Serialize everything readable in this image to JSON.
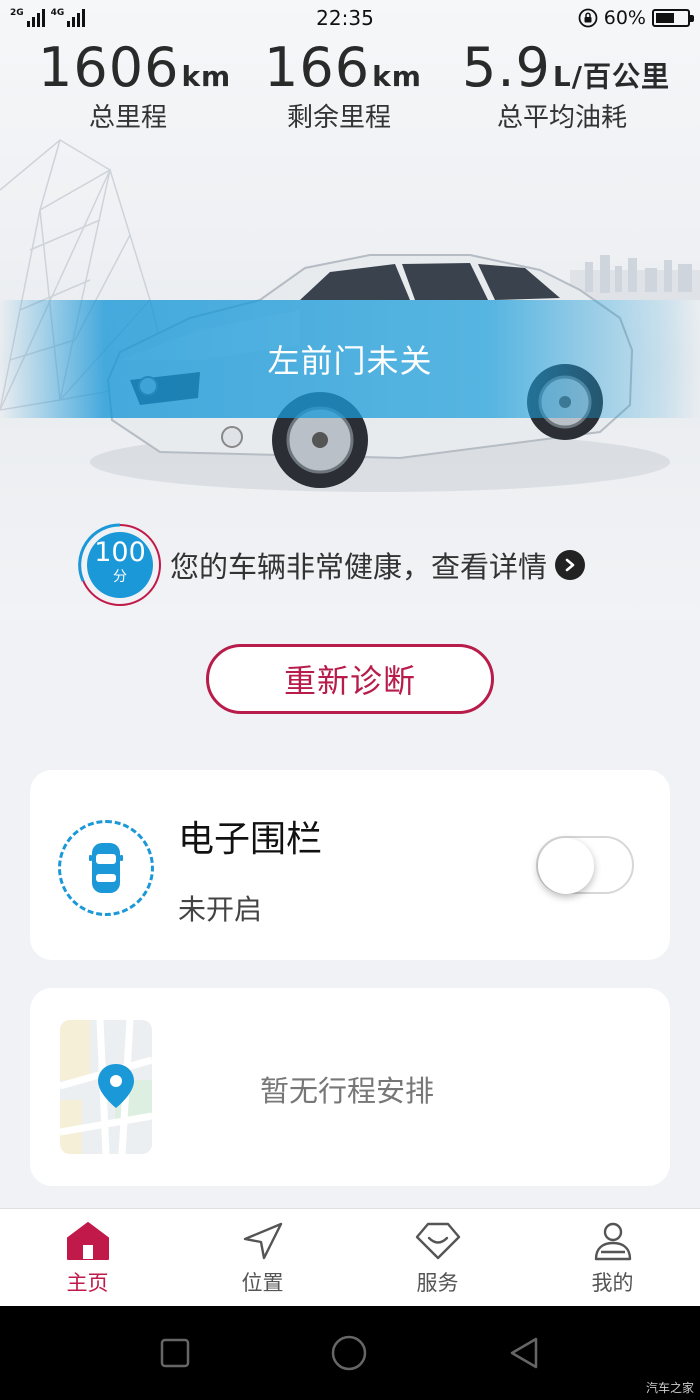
{
  "status_bar": {
    "network_1": "2G",
    "network_2": "4G",
    "time": "22:35",
    "battery_percent_label": "60%",
    "battery_level": 0.6
  },
  "stats": [
    {
      "value": "1606",
      "unit": "km",
      "label": "总里程"
    },
    {
      "value": "166",
      "unit": "km",
      "label": "剩余里程"
    },
    {
      "value": "5.9",
      "unit": "L/百公里",
      "label": "总平均油耗"
    }
  ],
  "alert": "左前门未关",
  "health": {
    "score": "100",
    "score_unit": "分",
    "text": "您的车辆非常健康，查看详情"
  },
  "diagnose_button": "重新诊断",
  "fence": {
    "title": "电子围栏",
    "status": "未开启",
    "enabled": false
  },
  "trip": {
    "empty_text": "暂无行程安排"
  },
  "nav": {
    "home": "主页",
    "location": "位置",
    "service": "服务",
    "mine": "我的",
    "active": "home"
  },
  "colors": {
    "accent": "#c0194a",
    "blue": "#1b98d8"
  },
  "watermark": "汽车之家"
}
